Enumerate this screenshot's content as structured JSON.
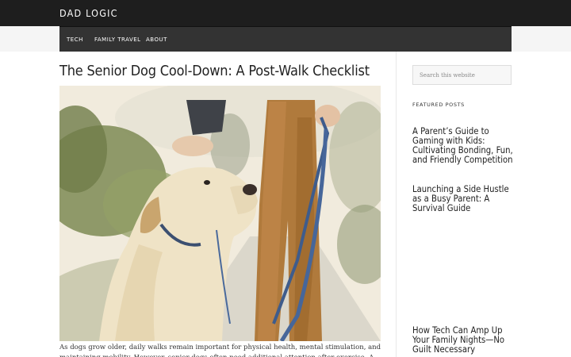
{
  "site": {
    "title": "DAD LOGIC"
  },
  "nav": [
    {
      "label": "TECH"
    },
    {
      "label": "FAMILY TRAVEL"
    },
    {
      "label": "ABOUT"
    }
  ],
  "post": {
    "title": "The Senior Dog Cool-Down: A Post-Walk Checklist",
    "excerpt": "As dogs grow older, daily walks remain important for physical health, mental stimulation, and maintaining mobility. However, senior dogs often need additional attention after exercise. A simple post-walk routine"
  },
  "sidebar": {
    "search_placeholder": "Search this website",
    "widget_title": "FEATURED POSTS",
    "featured": [
      {
        "title": "A Parent’s Guide to Gaming with Kids: Cultivating Bonding, Fun, and Friendly Competition"
      },
      {
        "title": "Launching a Side Hustle as a Busy Parent: A Survival Guide"
      },
      {
        "title": "How Tech Can Amp Up Your Family Nights—No Guilt Necessary"
      }
    ]
  }
}
